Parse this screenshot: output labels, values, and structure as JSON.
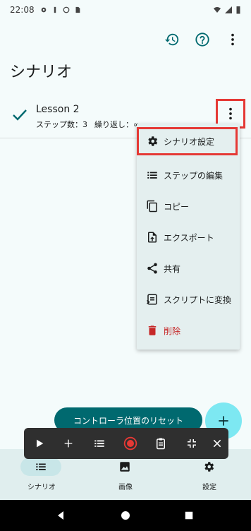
{
  "status_bar": {
    "time": "22:08"
  },
  "page": {
    "title": "シナリオ"
  },
  "scenario": {
    "name": "Lesson 2",
    "steps": "ステップ数：3",
    "repeat": "繰り返し：∞"
  },
  "menu": {
    "items": [
      {
        "label": "シナリオ設定",
        "icon": "gear-icon"
      },
      {
        "label": "ステップの編集",
        "icon": "list-icon"
      },
      {
        "label": "コピー",
        "icon": "copy-icon"
      },
      {
        "label": "エクスポート",
        "icon": "export-icon"
      },
      {
        "label": "共有",
        "icon": "share-icon"
      },
      {
        "label": "スクリプトに変換",
        "icon": "script-icon"
      },
      {
        "label": "削除",
        "icon": "trash-icon"
      }
    ]
  },
  "reset_button": {
    "label": "コントローラ位置のリセット"
  },
  "bottom_nav": {
    "items": [
      {
        "label": "シナリオ",
        "icon": "list-icon",
        "active": true
      },
      {
        "label": "画像",
        "icon": "image-icon",
        "active": false
      },
      {
        "label": "設定",
        "icon": "gear-icon",
        "active": false
      }
    ]
  },
  "colors": {
    "accent": "#00696f",
    "highlight": "#e53935",
    "record": "#e53935",
    "danger": "#c62828",
    "fab": "#7de8f2"
  }
}
